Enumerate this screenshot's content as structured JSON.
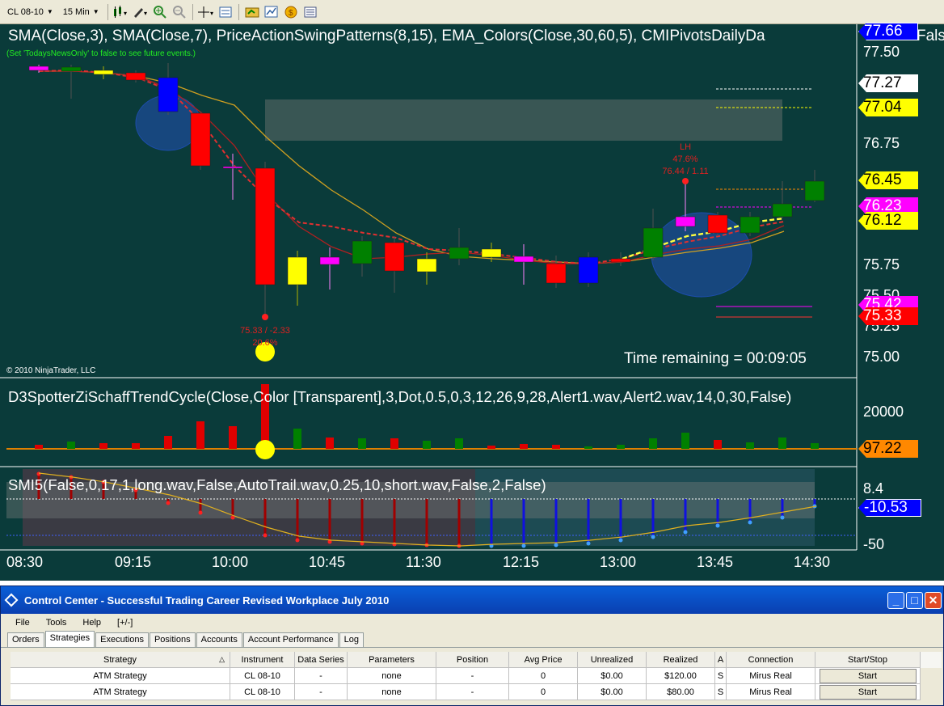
{
  "toolbar": {
    "instrument": "CL 08-10",
    "interval": "15 Min"
  },
  "chart": {
    "price_indicators_title": "SMA(Close,3),  SMA(Close,7),  PriceActionSwingPatterns(8,15),  EMA_Colors(Close,30,60,5),  CMIPivotsDailyDa",
    "price_indicators_title_tail": "Fals",
    "news_hint": "(Set 'TodaysNewsOnly' to false to see future events.)",
    "copyright": "© 2010 NinjaTrader, LLC",
    "time_remaining": "Time remaining = 00:09:05",
    "schaff_title": "D3SpotterZiSchaffTrendCycle(Close,Color [Transparent],3,Dot,0.5,0,3,12,26,9,28,Alert1.wav,Alert2.wav,14,0,30,False)",
    "smi_title": "SMI5(False,0,17,1,long.wav,False,AutoTrail.wav,0.25,10,short.wav,False,2,False)",
    "price_axis": [
      "77.50",
      "76.75",
      "75.75",
      "75.50",
      "75.25",
      "75.00"
    ],
    "schaff_axis": "20000",
    "smi_axis": [
      "8.4",
      "-50"
    ],
    "time_axis": [
      "08:30",
      "09:15",
      "10:00",
      "10:45",
      "11:30",
      "12:15",
      "13:00",
      "13:45",
      "14:30"
    ],
    "price_tags": [
      {
        "value": "77.66",
        "bg": "#0000ff",
        "fg": "#ffffff"
      },
      {
        "value": "77.27",
        "bg": "#ffffff",
        "fg": "#000000"
      },
      {
        "value": "77.04",
        "bg": "#ffff00",
        "fg": "#000000"
      },
      {
        "value": "76.45",
        "bg": "#ffff00",
        "fg": "#000000"
      },
      {
        "value": "76.23",
        "bg": "#ff00ff",
        "fg": "#ffffff"
      },
      {
        "value": "76.12",
        "bg": "#ffff00",
        "fg": "#000000"
      },
      {
        "value": "75.42",
        "bg": "#ff00ff",
        "fg": "#ffffff"
      },
      {
        "value": "75.33",
        "bg": "#ff0000",
        "fg": "#ffffff"
      },
      {
        "value": "97.22",
        "bg": "#ff8800",
        "fg": "#000000"
      },
      {
        "value": "-10.53",
        "bg": "#0000ff",
        "fg": "#ffffff"
      }
    ],
    "swing_high": {
      "label": "LH",
      "pct": "47.6%",
      "info": "76.44 / 1.11"
    },
    "swing_low": {
      "info": "75.33 / -2.33",
      "pct": "20.6%"
    }
  },
  "control_center": {
    "title": "Control Center - Successful Trading Career Revised Workplace July 2010",
    "menu": [
      "File",
      "Tools",
      "Help",
      "[+/-]"
    ],
    "tabs": [
      "Orders",
      "Strategies",
      "Executions",
      "Positions",
      "Accounts",
      "Account Performance",
      "Log"
    ],
    "active_tab": "Strategies",
    "columns": [
      "Strategy",
      "Instrument",
      "Data Series",
      "Parameters",
      "Position",
      "Avg Price",
      "Unrealized",
      "Realized",
      "A",
      "Connection",
      "Start/Stop"
    ],
    "rows": [
      [
        "ATM Strategy",
        "CL 08-10",
        "-",
        "none",
        "-",
        "0",
        "$0.00",
        "$120.00",
        "S",
        "Mirus Real",
        "Start"
      ],
      [
        "ATM Strategy",
        "CL 08-10",
        "-",
        "none",
        "-",
        "0",
        "$0.00",
        "$80.00",
        "S",
        "Mirus Real",
        "Start"
      ]
    ]
  }
}
